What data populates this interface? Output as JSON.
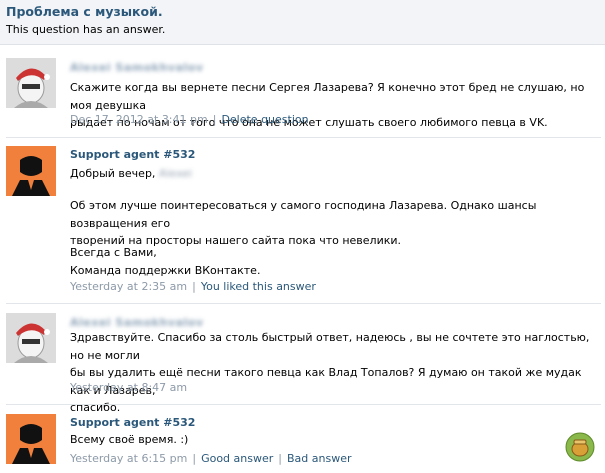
{
  "header": {
    "title": "Проблема с музыкой.",
    "status": "This question has an answer."
  },
  "posts": [
    {
      "author": "Alexei Samokhvalov",
      "text_lines": [
        "Скажите когда вы вернете песни Сергея Лазарева? Я конечно этот бред не слушаю, но моя девушка",
        "рыдает по ночам от того что она не может слушать своего любимого певца в VK."
      ],
      "date": "Dec 17, 2012 at 3:41 pm",
      "action": "Delete question"
    },
    {
      "author": "Support agent #532",
      "greeting": "Добрый вечер,",
      "greeting_name": "Alexei",
      "paragraph1": [
        "Об этом лучше поинтересоваться у самого господина Лазарева. Однако шансы возвращения его",
        "творений на просторы нашего сайта пока что невелики."
      ],
      "signature": [
        "Всегда с Вами,",
        "Команда поддержки ВКонтакте."
      ],
      "date": "Yesterday at 2:35 am",
      "liked": "You liked this answer"
    },
    {
      "author": "Alexei Samokhvalov",
      "text_lines": [
        "Здравствуйте. Спасибо за столь быстрый ответ, надеюсь , вы не сочтете это наглостью, но не могли",
        "бы вы удалить ещё песни такого певца как Влад Топалов? Я думаю он такой же мудак как и Лазарев,",
        "спасибо."
      ],
      "date": "Yesterday at 8:47 am"
    },
    {
      "author": "Support agent #532",
      "text_lines": [
        "Всему своё время. :)"
      ],
      "date": "Yesterday at 6:15 pm",
      "good": "Good answer",
      "bad": "Bad answer"
    }
  ],
  "colors": {
    "link": "#2b587a",
    "meta": "#8d9aa8",
    "header_bg": "#f2f4f7"
  }
}
